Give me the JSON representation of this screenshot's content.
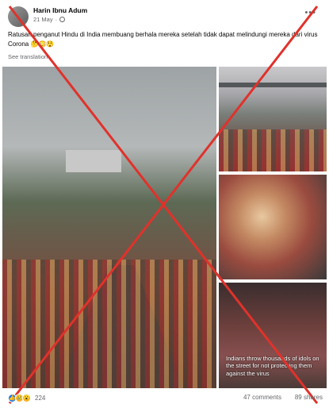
{
  "post": {
    "author": "Harin Ibnu Adum",
    "date": "21 May",
    "more_icon": "more-dots-icon",
    "caption": "Ratusan penganut Hindu di India membuang berhala mereka setelah tidak dapat melindungi mereka dari virus Corona",
    "caption_emoji": "🤔😳😲",
    "see_translation": "See translation"
  },
  "images": {
    "overlay_text": "Indians throw thousands of idols on the street for not protecting them against the virus"
  },
  "footer": {
    "reaction_count": "224",
    "comments": "47 comments",
    "shares": "89 shares"
  },
  "colors": {
    "x_mark": "#e0322b",
    "link": "#65676b"
  }
}
